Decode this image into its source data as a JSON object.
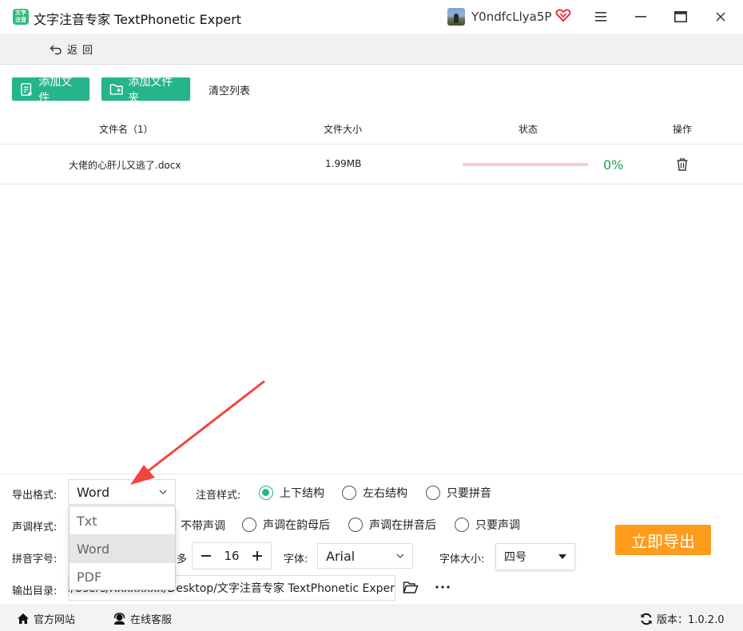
{
  "titlebar": {
    "logo_text": "文字\n注音",
    "title": "文字注音专家 TextPhonetic Expert",
    "username": "Y0ndfcLlya5P"
  },
  "backbar": {
    "back_label": "返回"
  },
  "toolbar": {
    "add_file": "添加文件",
    "add_folder": "添加文件夹",
    "clear_list": "清空列表"
  },
  "table": {
    "headers": [
      "文件名（1）",
      "文件大小",
      "状态",
      "操作"
    ],
    "rows": [
      {
        "name": "大佬的心肝儿又逃了.docx",
        "size": "1.99MB",
        "progress": 0,
        "progress_text": "0%"
      }
    ]
  },
  "settings": {
    "export_format_label": "导出格式:",
    "export_format_value": "Word",
    "export_format_options": [
      "Txt",
      "Word",
      "PDF"
    ],
    "annotation_style_label": "注音样式:",
    "annotation_styles": [
      "上下结构",
      "左右结构",
      "只要拼音"
    ],
    "annotation_style_selected": 0,
    "tone_style_label": "声调样式:",
    "tone_styles": [
      "不带声调",
      "声调在韵母后",
      "声调在拼音后",
      "只要声调"
    ],
    "pinyin_size_label": "拼音字号:",
    "pinyin_size_suffix": "多",
    "pinyin_size_value": "16",
    "font_label": "字体:",
    "font_value": "Arial",
    "font_size_label": "字体大小:",
    "font_size_value": "四号",
    "output_dir_label": "输出目录:",
    "output_dir_value": "C:/Users/Xxxxxxxx/Desktop/文字注音专家 TextPhonetic Expert",
    "export_button": "立即导出"
  },
  "statusbar": {
    "website": "官方网站",
    "support": "在线客服",
    "version": "版本：1.0.2.0"
  },
  "colors": {
    "accent": "#25b48b",
    "export": "#ff9b1a",
    "progress_text": "#1aa34a",
    "annotation_arrow": "#f0453a"
  }
}
